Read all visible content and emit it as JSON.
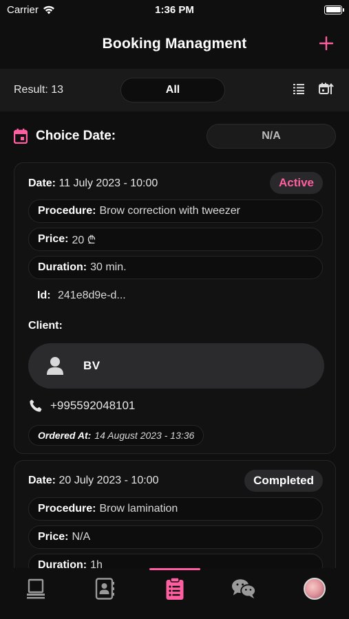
{
  "status_bar": {
    "carrier": "Carrier",
    "time": "1:36 PM"
  },
  "nav": {
    "title": "Booking Managment",
    "add_icon": "plus-icon"
  },
  "filter": {
    "result_text": "Result: 13",
    "status_filter": "All",
    "icons": [
      "list-icon",
      "calendar-sort-icon"
    ]
  },
  "date_filter": {
    "label": "Choice Date:",
    "value": "N/A",
    "icon": "calendar-icon"
  },
  "bookings": [
    {
      "date_label": "Date:",
      "date_value": "11 July 2023 - 10:00",
      "status": "Active",
      "procedure_label": "Procedure:",
      "procedure_value": "Brow correction with tweezer",
      "price_label": "Price:",
      "price_value": "20 ₾",
      "duration_label": "Duration:",
      "duration_value": "30 min.",
      "id_label": "Id:",
      "id_value": "241e8d9e-d...",
      "client_label": "Client:",
      "client_name": "BV",
      "phone": "+995592048101",
      "ordered_label": "Ordered At:",
      "ordered_value": "14 August 2023 - 13:36"
    },
    {
      "date_label": "Date:",
      "date_value": "20 July 2023 - 10:00",
      "status": "Completed",
      "procedure_label": "Procedure:",
      "procedure_value": "Brow lamination",
      "price_label": "Price:",
      "price_value": "N/A",
      "duration_label": "Duration:",
      "duration_value": "1h"
    }
  ],
  "tabs": [
    {
      "icon": "laptop-icon"
    },
    {
      "icon": "contacts-icon"
    },
    {
      "icon": "clipboard-icon",
      "active": true
    },
    {
      "icon": "chat-icon"
    },
    {
      "icon": "profile-avatar"
    }
  ],
  "colors": {
    "accent": "#ff5fa0",
    "background": "#0f0f10",
    "surface": "#1a1a1b",
    "badge": "#29292b"
  }
}
